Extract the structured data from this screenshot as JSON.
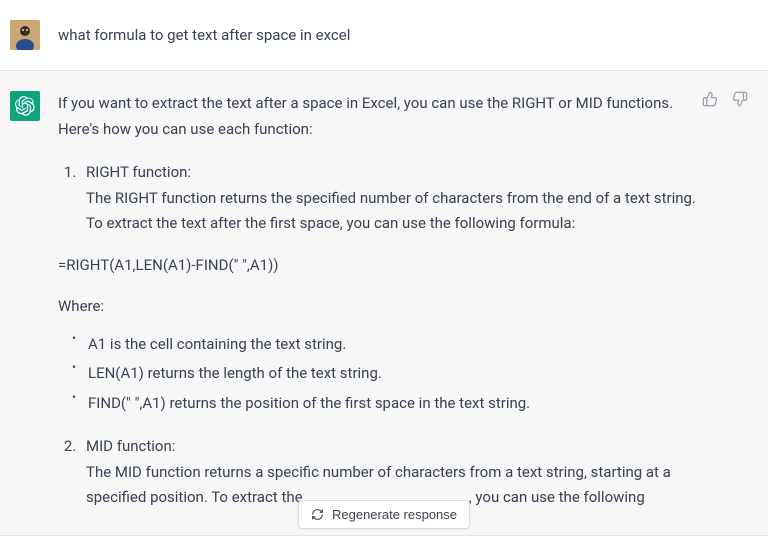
{
  "user": {
    "message": "what formula to get text after space in excel"
  },
  "assistant": {
    "intro": "If you want to extract the text after a space in Excel, you can use the RIGHT or MID functions. Here's how you can use each function:",
    "item1": {
      "title": "RIGHT function:",
      "desc": "The RIGHT function returns the specified number of characters from the end of a text string. To extract the text after the first space, you can use the following formula:"
    },
    "formula1": "=RIGHT(A1,LEN(A1)-FIND(\" \",A1))",
    "where_label": "Where:",
    "bullets": {
      "b1": "A1 is the cell containing the text string.",
      "b2": "LEN(A1) returns the length of the text string.",
      "b3": "FIND(\" \",A1) returns the position of the first space in the text string."
    },
    "item2": {
      "title": "MID function:",
      "desc_part1": "The MID function returns a specific number of characters from a text string, starting at a specified position. To extract the",
      "desc_part2": ", you can use the following"
    }
  },
  "controls": {
    "regenerate": "Regenerate response"
  }
}
